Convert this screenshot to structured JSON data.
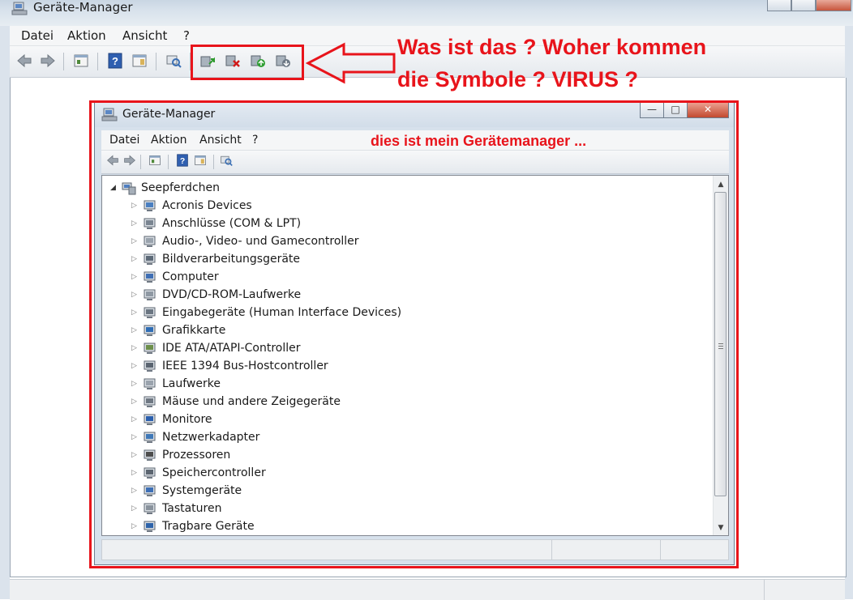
{
  "outer_window": {
    "title": "Geräte-Manager",
    "menu": [
      "Datei",
      "Aktion",
      "Ansicht",
      "?"
    ],
    "toolbar_icons": [
      "back-arrow-icon",
      "forward-arrow-icon",
      "properties-icon",
      "help-icon",
      "details-icon",
      "scan-hardware-icon",
      "update-driver-icon",
      "uninstall-icon",
      "enable-device-icon",
      "disable-device-icon"
    ]
  },
  "annotation": {
    "line1": "Was ist das ?  Woher kommen",
    "line2": "die Symbole ?  VIRUS ?",
    "inner_note": "dies ist mein Gerätemanager ...",
    "color": "#e8141b"
  },
  "inner_window": {
    "title": "Geräte-Manager",
    "menu": [
      "Datei",
      "Aktion",
      "Ansicht",
      "?"
    ],
    "tree": {
      "root": "Seepferdchen",
      "items": [
        {
          "label": "Acronis Devices",
          "icon": "network-device-icon"
        },
        {
          "label": "Anschlüsse (COM & LPT)",
          "icon": "port-icon"
        },
        {
          "label": "Audio-, Video- und Gamecontroller",
          "icon": "speaker-icon"
        },
        {
          "label": "Bildverarbeitungsgeräte",
          "icon": "camera-icon"
        },
        {
          "label": "Computer",
          "icon": "computer-icon"
        },
        {
          "label": "DVD/CD-ROM-Laufwerke",
          "icon": "dvd-drive-icon"
        },
        {
          "label": "Eingabegeräte (Human Interface Devices)",
          "icon": "hid-icon"
        },
        {
          "label": "Grafikkarte",
          "icon": "display-adapter-icon"
        },
        {
          "label": "IDE ATA/ATAPI-Controller",
          "icon": "ide-controller-icon"
        },
        {
          "label": "IEEE 1394 Bus-Hostcontroller",
          "icon": "firewire-icon"
        },
        {
          "label": "Laufwerke",
          "icon": "disk-drive-icon"
        },
        {
          "label": "Mäuse und andere Zeigegeräte",
          "icon": "mouse-icon"
        },
        {
          "label": "Monitore",
          "icon": "monitor-icon"
        },
        {
          "label": "Netzwerkadapter",
          "icon": "network-adapter-icon"
        },
        {
          "label": "Prozessoren",
          "icon": "processor-icon"
        },
        {
          "label": "Speichercontroller",
          "icon": "storage-controller-icon"
        },
        {
          "label": "Systemgeräte",
          "icon": "system-device-icon"
        },
        {
          "label": "Tastaturen",
          "icon": "keyboard-icon"
        },
        {
          "label": "Tragbare Geräte",
          "icon": "portable-device-icon"
        }
      ]
    }
  }
}
